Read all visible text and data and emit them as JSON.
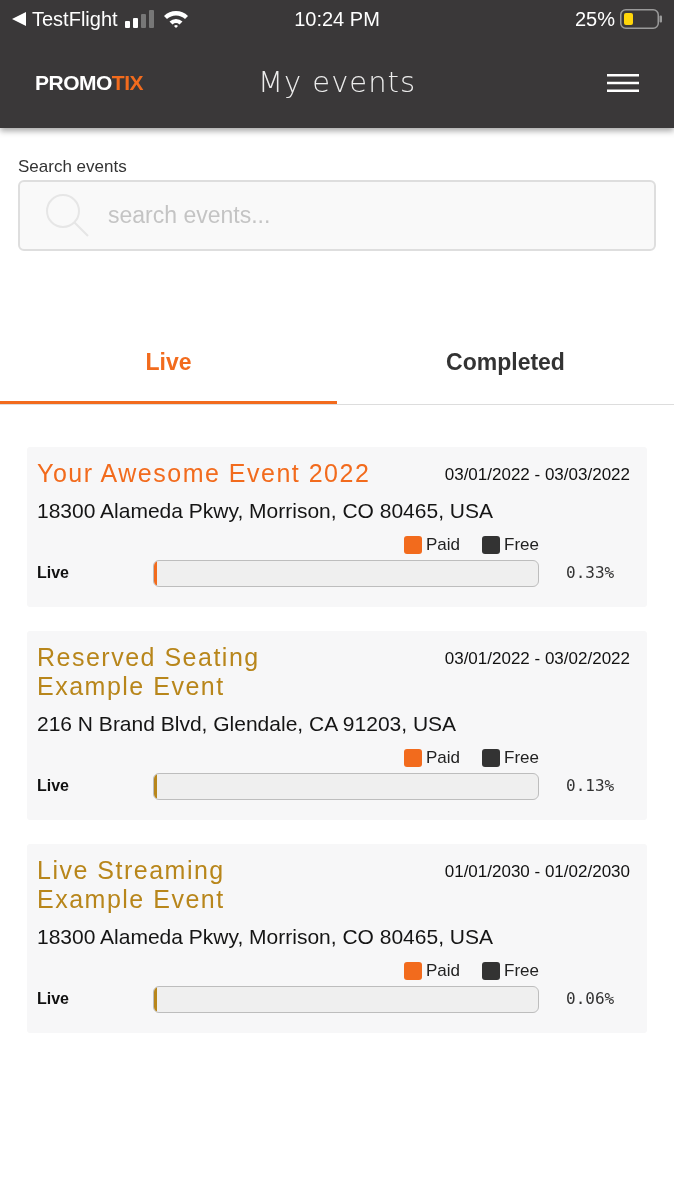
{
  "status_bar": {
    "back_app": "TestFlight",
    "time": "10:24 PM",
    "battery": "25%"
  },
  "header": {
    "logo": [
      {
        "text": "PROMO",
        "color": "#ffffff"
      },
      {
        "text": "TIX",
        "color": "#f26b1d"
      }
    ],
    "title": "My events"
  },
  "search": {
    "label": "Search events",
    "placeholder": "search events..."
  },
  "tabs": [
    {
      "label": "Live",
      "selected": true
    },
    {
      "label": "Completed",
      "selected": false
    }
  ],
  "events": [
    {
      "title": "Your Awesome Event 2022",
      "color": "#f26b1d",
      "dates": "03/01/2022 - 03/03/2022",
      "address": "18300 Alameda Pkwy, Morrison, CO 80465, USA",
      "legend": [
        {
          "label": "Paid",
          "color": "#f26b1d"
        },
        {
          "label": "Free",
          "color": "#333333"
        }
      ],
      "status": "Live",
      "level": 0.0033,
      "percent": "0.33%"
    },
    {
      "title": "Reserved Seating Example Event",
      "color": "#b8861b",
      "dates": "03/01/2022 - 03/02/2022",
      "address": "216 N Brand Blvd, Glendale, CA 91203, USA",
      "legend": [
        {
          "label": "Paid",
          "color": "#f26b1d"
        },
        {
          "label": "Free",
          "color": "#333333"
        }
      ],
      "status": "Live",
      "level": 0.0013,
      "percent": "0.13%"
    },
    {
      "title": "Live Streaming Example Event",
      "color": "#b8861b",
      "dates": "01/01/2030 - 01/02/2030",
      "address": "18300 Alameda Pkwy, Morrison, CO 80465, USA",
      "legend": [
        {
          "label": "Paid",
          "color": "#f26b1d"
        },
        {
          "label": "Free",
          "color": "#333333"
        }
      ],
      "status": "Live",
      "level": 0.0006,
      "percent": "0.06%"
    }
  ]
}
